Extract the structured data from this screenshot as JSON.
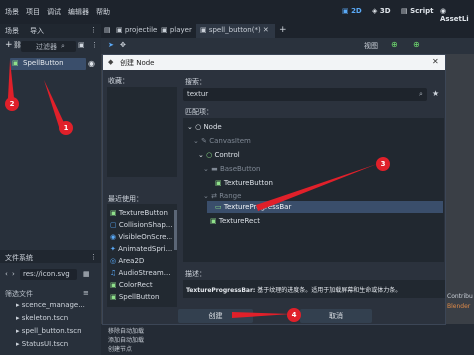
{
  "menubar": {
    "items": [
      "场景",
      "项目",
      "调试",
      "编辑器",
      "帮助"
    ],
    "modes": [
      "2D",
      "3D",
      "Script",
      "AssetLi"
    ]
  },
  "scene_dock": {
    "tabs": [
      "场景",
      "导入"
    ],
    "filter_label": "过滤器",
    "root_node": "SpellButton"
  },
  "filesystem_dock": {
    "tab": "文件系统",
    "path": "res://icon.svg",
    "filter_label": "筛选文件",
    "files": [
      "scence_manage...",
      "skeleton.tscn",
      "spell_button.tscn",
      "StatusUI.tscn"
    ]
  },
  "editor_tabs": {
    "tabs": [
      "projectile",
      "player",
      "spell_button(*)"
    ],
    "view_label": "视图"
  },
  "bottom_panel": {
    "log": [
      "移除自动加载",
      "添加自动加载",
      "创建节点"
    ]
  },
  "right_edge": [
    "Contribu",
    "Blender"
  ],
  "dialog": {
    "title": "创建 Node",
    "favorites_label": "收藏：",
    "recent_label": "最近使用：",
    "search_label": "搜索：",
    "search_value": "textur",
    "matches_label": "匹配项：",
    "tree": [
      "Node",
      "CanvasItem",
      "Control",
      "BaseButton",
      "TextureButton",
      "Range",
      "TextureProgressBar",
      "TextureRect"
    ],
    "recent": [
      "TextureButton",
      "CollisionShap...",
      "VisibleOnScre...",
      "AnimatedSpri...",
      "Area2D",
      "AudioStream...",
      "ColorRect",
      "SpellButton"
    ],
    "description_label": "描述：",
    "description_name": "TextureProgressBar:",
    "description_text": " 基于纹理的进度条。适用于加载屏幕和生命或体力条。",
    "create_button": "创建",
    "cancel_button": "取消"
  },
  "annotations": [
    "1",
    "2",
    "3",
    "4"
  ],
  "colors": {
    "accent": "#5aa9f6",
    "selection": "#3a4e6b",
    "annotation": "#e0202a"
  }
}
